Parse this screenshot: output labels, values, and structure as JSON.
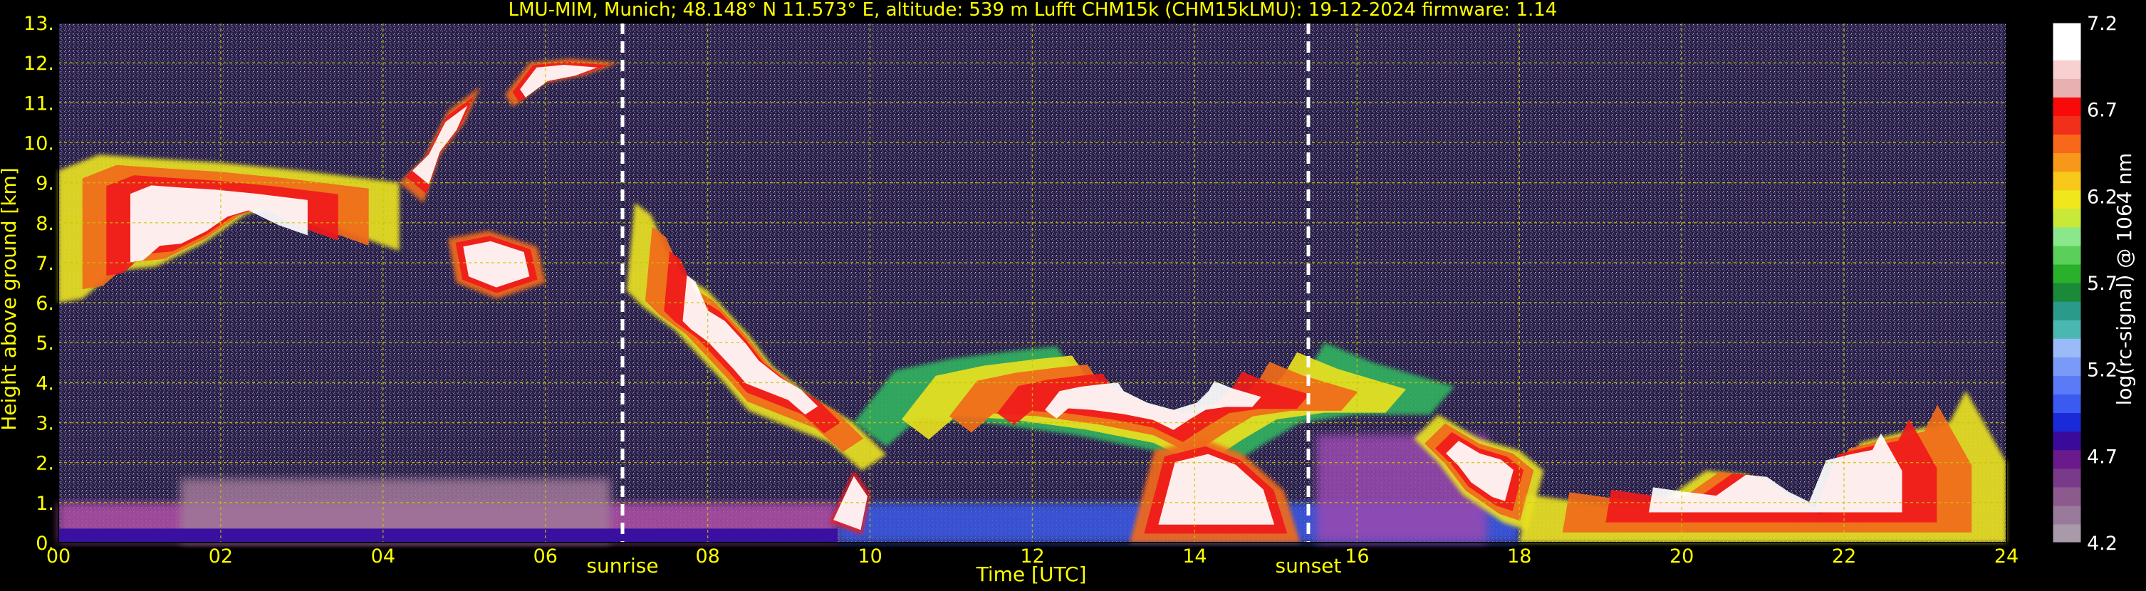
{
  "title": "LMU-MIM, Munich; 48.148° N 11.573° E, altitude: 539 m    Lufft CHM15k (CHM15kLMU): 19-12-2024    firmware: 1.14",
  "colors": {
    "background": "#000000",
    "text": "#ffff00",
    "colorbar_text": "#ffffff",
    "grid": "#c8c800",
    "marker": "#ffffff"
  },
  "chart_data": {
    "type": "heatmap",
    "title": "LMU-MIM, Munich; 48.148° N 11.573° E, altitude: 539 m    Lufft CHM15k (CHM15kLMU): 19-12-2024    firmware: 1.14",
    "xlabel": "Time [UTC]",
    "ylabel": "Height above ground [km]",
    "xlim": [
      0,
      24
    ],
    "ylim": [
      0,
      13
    ],
    "x_ticks": [
      0,
      2,
      4,
      6,
      8,
      10,
      12,
      14,
      16,
      18,
      20,
      22,
      24
    ],
    "x_tick_labels": [
      "00",
      "02",
      "04",
      "06",
      "08",
      "10",
      "12",
      "14",
      "16",
      "18",
      "20",
      "22",
      "24"
    ],
    "y_ticks": [
      0,
      1,
      2,
      3,
      4,
      5,
      6,
      7,
      8,
      9,
      10,
      11,
      12,
      13
    ],
    "y_tick_labels": [
      "0.",
      "1.",
      "2.",
      "3.",
      "4.",
      "5.",
      "6.",
      "7.",
      "8.",
      "9.",
      "10.",
      "11.",
      "12.",
      "13."
    ],
    "grid": true,
    "markers": [
      {
        "label": "sunrise",
        "x": 6.95
      },
      {
        "label": "sunset",
        "x": 15.4
      }
    ],
    "colorbar": {
      "label": "log(rc-signal) @ 1064 nm",
      "min": 4.2,
      "max": 7.2,
      "tick_values": [
        4.2,
        4.7,
        5.2,
        5.7,
        6.2,
        6.7,
        7.2
      ],
      "tick_labels": [
        "4.2",
        "4.7",
        "5.2",
        "5.7",
        "6.2",
        "6.7",
        "7.2"
      ],
      "colors": [
        "#a89aa8",
        "#9a7a9a",
        "#8c5a8c",
        "#7a3a8a",
        "#6a1a8a",
        "#3a0a9a",
        "#1a2ad8",
        "#3a5af0",
        "#5a7af8",
        "#7a9af8",
        "#9abaf8",
        "#4ab8b0",
        "#2a9a8a",
        "#1a8a3a",
        "#2ab02a",
        "#5ad05a",
        "#8ae88a",
        "#c8e83a",
        "#f0e81a",
        "#f8c81a",
        "#f8981a",
        "#f8681a",
        "#f0301a",
        "#f80a0a",
        "#e8b0b0",
        "#f8d0d0",
        "#ffffff",
        "#ffffff"
      ]
    },
    "layers": [
      {
        "name": "cloud-1",
        "points": [
          [
            0.0,
            6.0
          ],
          [
            0.0,
            9.3
          ],
          [
            0.5,
            9.7
          ],
          [
            1.2,
            9.6
          ],
          [
            2.0,
            9.5
          ],
          [
            3.0,
            9.3
          ],
          [
            4.2,
            9.0
          ],
          [
            4.2,
            7.3
          ],
          [
            3.5,
            7.8
          ],
          [
            2.8,
            8.5
          ],
          [
            2.3,
            8.2
          ],
          [
            1.8,
            7.5
          ],
          [
            1.2,
            6.9
          ],
          [
            0.7,
            6.8
          ],
          [
            0.3,
            6.1
          ]
        ],
        "layers": 4
      },
      {
        "name": "cloud-2",
        "points": [
          [
            4.2,
            9.0
          ],
          [
            4.5,
            9.6
          ],
          [
            4.8,
            10.8
          ],
          [
            5.2,
            11.4
          ],
          [
            5.0,
            10.5
          ],
          [
            4.7,
            9.7
          ],
          [
            4.5,
            8.5
          ]
        ],
        "layers": 3
      },
      {
        "name": "cloud-3",
        "points": [
          [
            5.5,
            11.2
          ],
          [
            5.8,
            12.0
          ],
          [
            6.3,
            12.1
          ],
          [
            6.9,
            12.0
          ],
          [
            6.5,
            11.7
          ],
          [
            6.0,
            11.5
          ],
          [
            5.6,
            10.9
          ]
        ],
        "layers": 3
      },
      {
        "name": "cloud-4",
        "points": [
          [
            4.8,
            7.6
          ],
          [
            5.3,
            7.8
          ],
          [
            5.9,
            7.4
          ],
          [
            6.0,
            6.5
          ],
          [
            5.4,
            6.1
          ],
          [
            4.9,
            6.5
          ]
        ],
        "layers": 3
      },
      {
        "name": "cloud-5",
        "points": [
          [
            7.0,
            6.3
          ],
          [
            7.1,
            8.5
          ],
          [
            7.3,
            8.2
          ],
          [
            7.6,
            6.8
          ],
          [
            8.0,
            6.3
          ],
          [
            8.5,
            5.2
          ],
          [
            8.8,
            4.4
          ],
          [
            9.3,
            3.6
          ],
          [
            9.8,
            3.0
          ],
          [
            10.2,
            2.2
          ],
          [
            9.9,
            1.8
          ],
          [
            9.5,
            2.5
          ],
          [
            9.0,
            2.9
          ],
          [
            8.5,
            3.3
          ],
          [
            8.2,
            4.0
          ],
          [
            7.6,
            5.3
          ],
          [
            7.2,
            5.9
          ]
        ],
        "layers": 4
      },
      {
        "name": "cloud-6",
        "points": [
          [
            9.8,
            3.0
          ],
          [
            10.3,
            4.3
          ],
          [
            11.0,
            4.6
          ],
          [
            11.8,
            4.8
          ],
          [
            12.3,
            4.9
          ],
          [
            12.5,
            4.3
          ],
          [
            13.3,
            3.5
          ],
          [
            14.2,
            3.0
          ],
          [
            15.0,
            3.5
          ],
          [
            15.4,
            4.3
          ],
          [
            15.6,
            5.0
          ],
          [
            16.2,
            4.5
          ],
          [
            17.2,
            3.9
          ],
          [
            16.9,
            3.2
          ],
          [
            16.0,
            3.2
          ],
          [
            15.3,
            3.0
          ],
          [
            14.8,
            2.4
          ],
          [
            14.2,
            1.6
          ],
          [
            13.5,
            2.3
          ],
          [
            12.5,
            2.7
          ],
          [
            11.4,
            3.0
          ],
          [
            10.6,
            3.1
          ],
          [
            10.2,
            2.4
          ]
        ],
        "layers": 5
      },
      {
        "name": "cloud-7",
        "points": [
          [
            17.0,
            3.2
          ],
          [
            17.5,
            2.6
          ],
          [
            18.0,
            2.3
          ],
          [
            18.3,
            1.8
          ],
          [
            18.1,
            0.3
          ],
          [
            17.8,
            0.5
          ],
          [
            17.3,
            1.2
          ],
          [
            17.0,
            2.0
          ],
          [
            16.7,
            2.6
          ]
        ],
        "layers": 4
      },
      {
        "name": "cloud-8",
        "points": [
          [
            18.0,
            0.0
          ],
          [
            18.1,
            1.2
          ],
          [
            18.8,
            1.0
          ],
          [
            19.6,
            0.8
          ],
          [
            20.3,
            1.8
          ],
          [
            20.8,
            1.7
          ],
          [
            21.3,
            1.0
          ],
          [
            21.8,
            0.5
          ],
          [
            22.2,
            2.5
          ],
          [
            22.8,
            2.8
          ],
          [
            23.3,
            3.0
          ],
          [
            23.5,
            3.8
          ],
          [
            24.0,
            2.0
          ],
          [
            24.0,
            0.0
          ]
        ],
        "layers": 4
      },
      {
        "name": "cloud-9",
        "points": [
          [
            13.2,
            0.0
          ],
          [
            13.5,
            2.3
          ],
          [
            14.1,
            2.6
          ],
          [
            14.6,
            2.2
          ],
          [
            15.1,
            1.3
          ],
          [
            15.3,
            0.0
          ]
        ],
        "layers": 3
      },
      {
        "name": "cloud-10",
        "points": [
          [
            9.5,
            0.5
          ],
          [
            9.8,
            1.8
          ],
          [
            10.0,
            1.2
          ],
          [
            9.9,
            0.2
          ]
        ],
        "layers": 2
      }
    ],
    "aerosol_layers": [
      {
        "name": "boundary-layer-morning",
        "x_from": 0,
        "x_to": 9.6,
        "y_top": 1.0,
        "color": "#b050a8"
      },
      {
        "name": "boundary-layer-morning-top",
        "x_from": 1.5,
        "x_to": 6.8,
        "y_top": 1.6,
        "color": "#a07898"
      },
      {
        "name": "boundary-layer-afternoon",
        "x_from": 9.6,
        "x_to": 18.0,
        "y_top": 1.0,
        "color": "#3a5ae8"
      },
      {
        "name": "boundary-layer-pm-top",
        "x_from": 15.5,
        "x_to": 17.6,
        "y_top": 2.7,
        "color": "#9a4ab0"
      }
    ]
  }
}
